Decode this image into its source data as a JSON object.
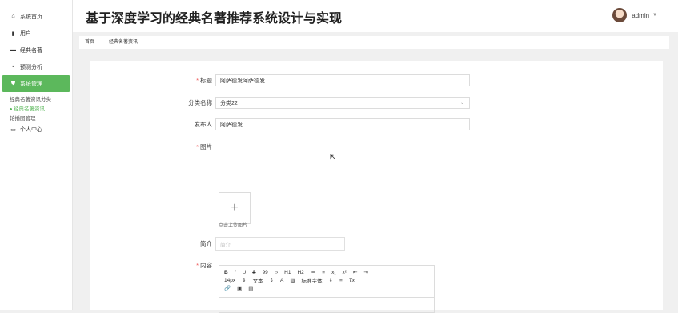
{
  "sidebar": {
    "items": [
      {
        "icon": "home-icon",
        "label": "系统首页"
      },
      {
        "icon": "user-icon",
        "label": "用户"
      },
      {
        "icon": "book-icon",
        "label": "经典名著"
      },
      {
        "icon": "chart-icon",
        "label": "预测分析"
      },
      {
        "icon": "shield-icon",
        "label": "系统管理"
      }
    ],
    "sub_items": [
      "经典名著资讯分类",
      "经典名著资讯",
      "轮播图管理"
    ],
    "personal": {
      "icon": "monitor-icon",
      "label": "个人中心"
    }
  },
  "header": {
    "title": "基于深度学习的经典名著推荐系统设计与实现",
    "user": "admin"
  },
  "breadcrumb": {
    "home": "首页",
    "separator": "——",
    "current": "经典名著资讯"
  },
  "form": {
    "title": {
      "label": "标题",
      "value": "阿萨德发阿萨德发"
    },
    "category": {
      "label": "分类名称",
      "value": "分类22"
    },
    "publisher": {
      "label": "发布人",
      "value": "阿萨德发"
    },
    "image": {
      "label": "图片",
      "upload_symbol": "+",
      "upload_hint": "点击上传图片"
    },
    "summary": {
      "label": "简介",
      "placeholder": "简介"
    },
    "content": {
      "label": "内容"
    }
  },
  "editor": {
    "row1": [
      "B",
      "I",
      "U",
      "S",
      "99",
      "‹›",
      "H1",
      "H2",
      "≔",
      "≡",
      "x₁",
      "x²",
      "⇤",
      "⇥"
    ],
    "row2": [
      "14px",
      "⇕",
      "文本",
      "⇕",
      "A",
      "▧",
      "标准字体",
      "⇕",
      "≡",
      "Tx"
    ],
    "row3": [
      "🔗",
      "▣",
      "▤"
    ]
  },
  "colors": {
    "accent": "#5cb85c",
    "required": "#ee5555"
  }
}
